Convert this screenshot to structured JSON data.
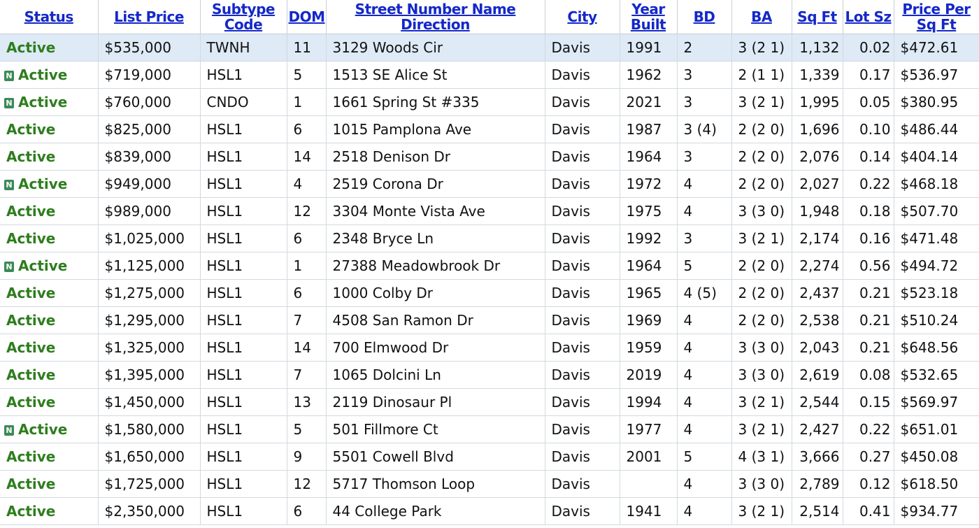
{
  "columns": [
    {
      "label": "Status"
    },
    {
      "label": "List Price"
    },
    {
      "label": "Subtype Code"
    },
    {
      "label": "DOM"
    },
    {
      "label": "Street Number Name Direction"
    },
    {
      "label": "City"
    },
    {
      "label": "Year Built"
    },
    {
      "label": "BD"
    },
    {
      "label": "BA"
    },
    {
      "label": "Sq Ft"
    },
    {
      "label": "Lot Sz"
    },
    {
      "label": "Price Per Sq Ft"
    }
  ],
  "new_badge": "N",
  "rows": [
    {
      "status": "Active",
      "new": false,
      "price": "$535,000",
      "subtype": "TWNH",
      "dom": "11",
      "street": "3129 Woods Cir",
      "city": "Davis",
      "year": "1991",
      "bd": "2",
      "ba": "3 (2 1)",
      "sqft": "1,132",
      "lot": "0.02",
      "ppsf": "$472.61"
    },
    {
      "status": "Active",
      "new": true,
      "price": "$719,000",
      "subtype": "HSL1",
      "dom": "5",
      "street": "1513 SE Alice St",
      "city": "Davis",
      "year": "1962",
      "bd": "3",
      "ba": "2 (1 1)",
      "sqft": "1,339",
      "lot": "0.17",
      "ppsf": "$536.97"
    },
    {
      "status": "Active",
      "new": true,
      "price": "$760,000",
      "subtype": "CNDO",
      "dom": "1",
      "street": "1661 Spring St #335",
      "city": "Davis",
      "year": "2021",
      "bd": "3",
      "ba": "3 (2 1)",
      "sqft": "1,995",
      "lot": "0.05",
      "ppsf": "$380.95"
    },
    {
      "status": "Active",
      "new": false,
      "price": "$825,000",
      "subtype": "HSL1",
      "dom": "6",
      "street": "1015 Pamplona Ave",
      "city": "Davis",
      "year": "1987",
      "bd": "3 (4)",
      "ba": "2 (2 0)",
      "sqft": "1,696",
      "lot": "0.10",
      "ppsf": "$486.44"
    },
    {
      "status": "Active",
      "new": false,
      "price": "$839,000",
      "subtype": "HSL1",
      "dom": "14",
      "street": "2518 Denison Dr",
      "city": "Davis",
      "year": "1964",
      "bd": "3",
      "ba": "2 (2 0)",
      "sqft": "2,076",
      "lot": "0.14",
      "ppsf": "$404.14"
    },
    {
      "status": "Active",
      "new": true,
      "price": "$949,000",
      "subtype": "HSL1",
      "dom": "4",
      "street": "2519 Corona Dr",
      "city": "Davis",
      "year": "1972",
      "bd": "4",
      "ba": "2 (2 0)",
      "sqft": "2,027",
      "lot": "0.22",
      "ppsf": "$468.18"
    },
    {
      "status": "Active",
      "new": false,
      "price": "$989,000",
      "subtype": "HSL1",
      "dom": "12",
      "street": "3304 Monte Vista Ave",
      "city": "Davis",
      "year": "1975",
      "bd": "4",
      "ba": "3 (3 0)",
      "sqft": "1,948",
      "lot": "0.18",
      "ppsf": "$507.70"
    },
    {
      "status": "Active",
      "new": false,
      "price": "$1,025,000",
      "subtype": "HSL1",
      "dom": "6",
      "street": "2348 Bryce Ln",
      "city": "Davis",
      "year": "1992",
      "bd": "3",
      "ba": "3 (2 1)",
      "sqft": "2,174",
      "lot": "0.16",
      "ppsf": "$471.48"
    },
    {
      "status": "Active",
      "new": true,
      "price": "$1,125,000",
      "subtype": "HSL1",
      "dom": "1",
      "street": "27388 Meadowbrook Dr",
      "city": "Davis",
      "year": "1964",
      "bd": "5",
      "ba": "2 (2 0)",
      "sqft": "2,274",
      "lot": "0.56",
      "ppsf": "$494.72"
    },
    {
      "status": "Active",
      "new": false,
      "price": "$1,275,000",
      "subtype": "HSL1",
      "dom": "6",
      "street": "1000 Colby Dr",
      "city": "Davis",
      "year": "1965",
      "bd": "4 (5)",
      "ba": "2 (2 0)",
      "sqft": "2,437",
      "lot": "0.21",
      "ppsf": "$523.18"
    },
    {
      "status": "Active",
      "new": false,
      "price": "$1,295,000",
      "subtype": "HSL1",
      "dom": "7",
      "street": "4508 San Ramon Dr",
      "city": "Davis",
      "year": "1969",
      "bd": "4",
      "ba": "2 (2 0)",
      "sqft": "2,538",
      "lot": "0.21",
      "ppsf": "$510.24"
    },
    {
      "status": "Active",
      "new": false,
      "price": "$1,325,000",
      "subtype": "HSL1",
      "dom": "14",
      "street": "700 Elmwood Dr",
      "city": "Davis",
      "year": "1959",
      "bd": "4",
      "ba": "3 (3 0)",
      "sqft": "2,043",
      "lot": "0.21",
      "ppsf": "$648.56"
    },
    {
      "status": "Active",
      "new": false,
      "price": "$1,395,000",
      "subtype": "HSL1",
      "dom": "7",
      "street": "1065 Dolcini Ln",
      "city": "Davis",
      "year": "2019",
      "bd": "4",
      "ba": "3 (3 0)",
      "sqft": "2,619",
      "lot": "0.08",
      "ppsf": "$532.65"
    },
    {
      "status": "Active",
      "new": false,
      "price": "$1,450,000",
      "subtype": "HSL1",
      "dom": "13",
      "street": "2119 Dinosaur Pl",
      "city": "Davis",
      "year": "1994",
      "bd": "4",
      "ba": "3 (2 1)",
      "sqft": "2,544",
      "lot": "0.15",
      "ppsf": "$569.97"
    },
    {
      "status": "Active",
      "new": true,
      "price": "$1,580,000",
      "subtype": "HSL1",
      "dom": "5",
      "street": "501 Fillmore Ct",
      "city": "Davis",
      "year": "1977",
      "bd": "4",
      "ba": "3 (2 1)",
      "sqft": "2,427",
      "lot": "0.22",
      "ppsf": "$651.01"
    },
    {
      "status": "Active",
      "new": false,
      "price": "$1,650,000",
      "subtype": "HSL1",
      "dom": "9",
      "street": "5501 Cowell Blvd",
      "city": "Davis",
      "year": "2001",
      "bd": "5",
      "ba": "4 (3 1)",
      "sqft": "3,666",
      "lot": "0.27",
      "ppsf": "$450.08"
    },
    {
      "status": "Active",
      "new": false,
      "price": "$1,725,000",
      "subtype": "HSL1",
      "dom": "12",
      "street": "5717 Thomson Loop",
      "city": "Davis",
      "year": "",
      "bd": "4",
      "ba": "3 (3 0)",
      "sqft": "2,789",
      "lot": "0.12",
      "ppsf": "$618.50"
    },
    {
      "status": "Active",
      "new": false,
      "price": "$2,350,000",
      "subtype": "HSL1",
      "dom": "6",
      "street": "44 College Park",
      "city": "Davis",
      "year": "1941",
      "bd": "4",
      "ba": "3 (2 1)",
      "sqft": "2,514",
      "lot": "0.41",
      "ppsf": "$934.77"
    }
  ]
}
